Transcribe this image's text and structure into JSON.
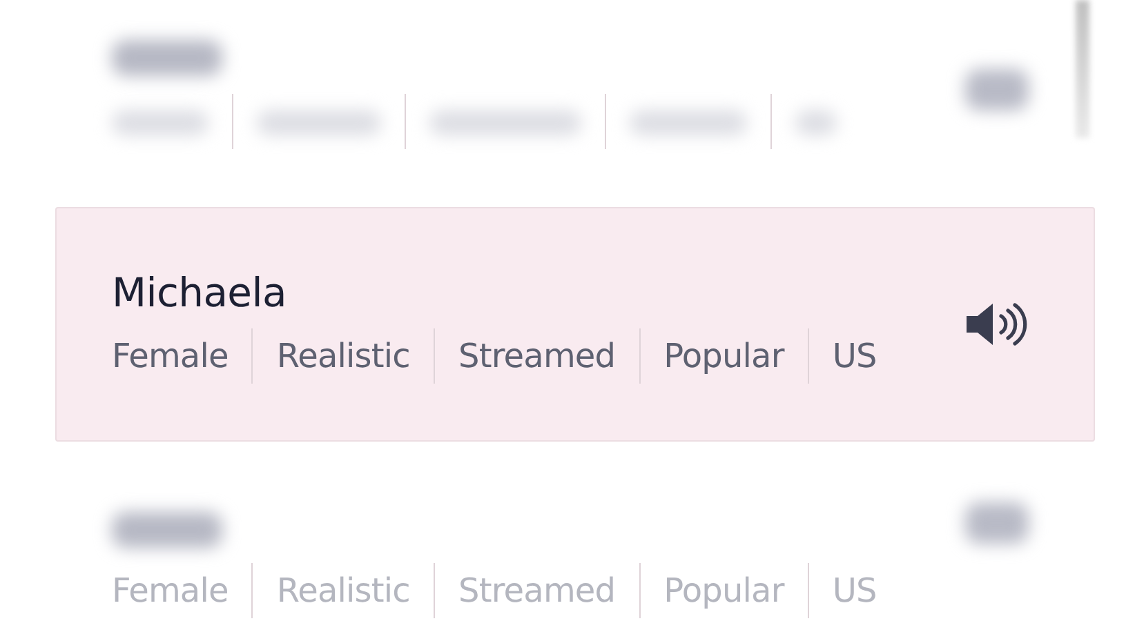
{
  "voices": [
    {
      "kind": "obscured",
      "selected": false
    },
    {
      "kind": "voice",
      "selected": true,
      "name": "Michaela",
      "tags": [
        "Female",
        "Realistic",
        "Streamed",
        "Popular",
        "US"
      ]
    },
    {
      "kind": "tags_only",
      "selected": false,
      "tags": [
        "Female",
        "Realistic",
        "Streamed",
        "Popular",
        "US"
      ]
    }
  ]
}
